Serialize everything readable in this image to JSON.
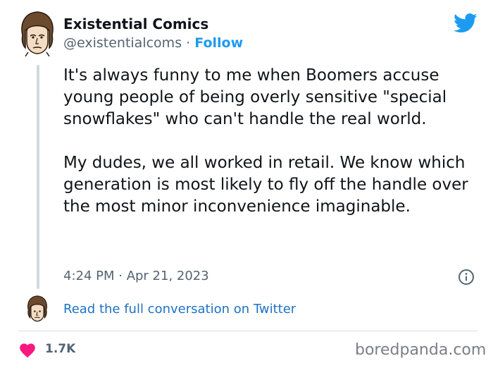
{
  "author": {
    "name": "Existential Comics",
    "handle": "@existentialcoms",
    "separator": "·",
    "follow_label": "Follow"
  },
  "tweet": {
    "paragraphs": [
      "It's always funny to me when Boomers accuse young people of being overly sensitive \"special snowflakes\" who can't handle the real world.",
      "My dudes, we all worked in retail. We know which generation is most likely to fly off the handle over the most minor inconvenience imaginable."
    ],
    "timestamp": "4:24 PM · Apr 21, 2023"
  },
  "conversation_link": "Read the full conversation on Twitter",
  "likes": {
    "count": "1.7K"
  },
  "watermark": "boredpanda.com",
  "icons": {
    "brand": "twitter-bird-icon",
    "info": "info-icon",
    "like": "heart-icon"
  },
  "colors": {
    "twitter_blue": "#1d9bf0",
    "link_blue": "#1d72c4",
    "heart_pink": "#f91880",
    "muted_text": "#536471",
    "thread_line": "#cfd9de"
  }
}
